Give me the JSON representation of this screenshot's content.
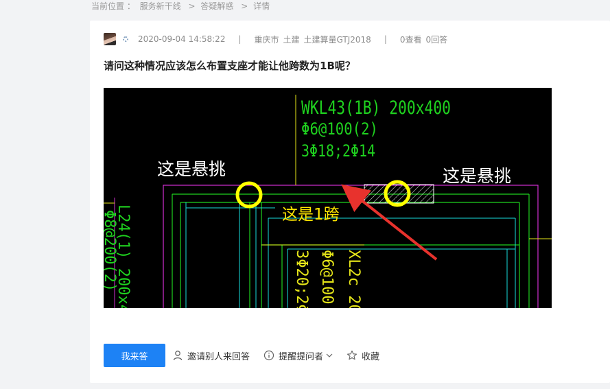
{
  "breadcrumb": {
    "label": "当前位置 ：",
    "items": [
      "服务新干线",
      "答疑解惑",
      "详情"
    ],
    "separator": ">"
  },
  "question": {
    "datetime": "2020-09-04 14:58:22",
    "city": "重庆市",
    "category": "土建",
    "software": "土建算量GTJ2018",
    "views": "0查看",
    "answers": "0回答",
    "title": "请问这种情况应该怎么布置支座才能让他跨数为1B呢？"
  },
  "drawing": {
    "labels": {
      "beam_name": "WKL43(1B) 200x400",
      "beam_stirrup": "Φ6@100(2)",
      "beam_rebar": "3Φ18;2Φ14",
      "left_beam_a": "L24(1) 200x4",
      "left_beam_b": "Φ8@200(2)",
      "mid_beam_a": "XL2c 20",
      "mid_beam_b": "Φ6@100",
      "mid_beam_c": "3Φ20;2Φ"
    },
    "annotations": {
      "cantilever_left": "这是悬挑",
      "cantilever_right": "这是悬挑",
      "span": "这是1跨"
    },
    "colors": {
      "background": "#000000",
      "magenta": "#d22fd2",
      "green": "#1fd21f",
      "cyan": "#19dede",
      "yellow_line": "#e6e619",
      "circle": "#ffff00",
      "arrow": "#e8322d"
    }
  },
  "actions": {
    "answer": "我来答",
    "invite": "邀请别人来回答",
    "remind": "提醒提问者",
    "favorite": "收藏"
  },
  "colors": {
    "primary": "#1d82f5",
    "page_bg": "#f2f3f5"
  }
}
